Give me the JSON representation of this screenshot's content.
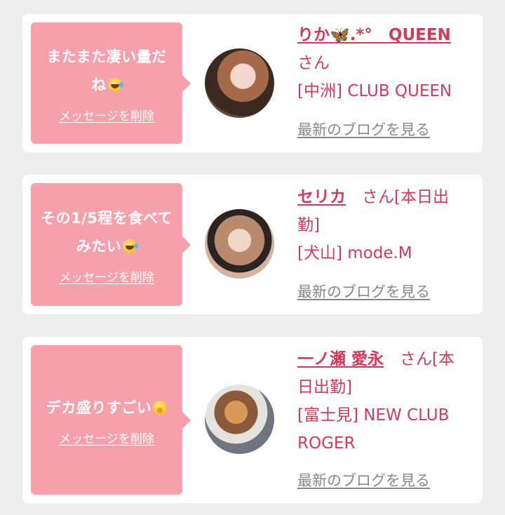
{
  "delete_label": "メッセージを削除",
  "blog_label": "最新のブログを見る",
  "cards": [
    {
      "message": "またまた凄い量だね",
      "emoji": "rolling-on-floor-laughing",
      "name": "りか🦋.*°　QUEEN",
      "suffix": "さん",
      "shop": "[中洲] CLUB QUEEN"
    },
    {
      "message": "その1/5程を食べてみたい",
      "emoji": "rolling-on-floor-laughing",
      "name": "セリカ",
      "suffix": "　さん[本日出勤]",
      "shop": "[犬山] mode.M"
    },
    {
      "message": "デカ盛りすごい",
      "emoji": "face-with-hand-over-mouth",
      "name": "一ノ瀬 愛永",
      "suffix": "　さん[本日出勤]",
      "shop": "[富士見] NEW CLUB ROGER"
    }
  ],
  "colors": {
    "bubble": "#f6a0ab",
    "accent": "#d23a5a",
    "link_gray": "#888888",
    "background": "#eeeeee"
  }
}
